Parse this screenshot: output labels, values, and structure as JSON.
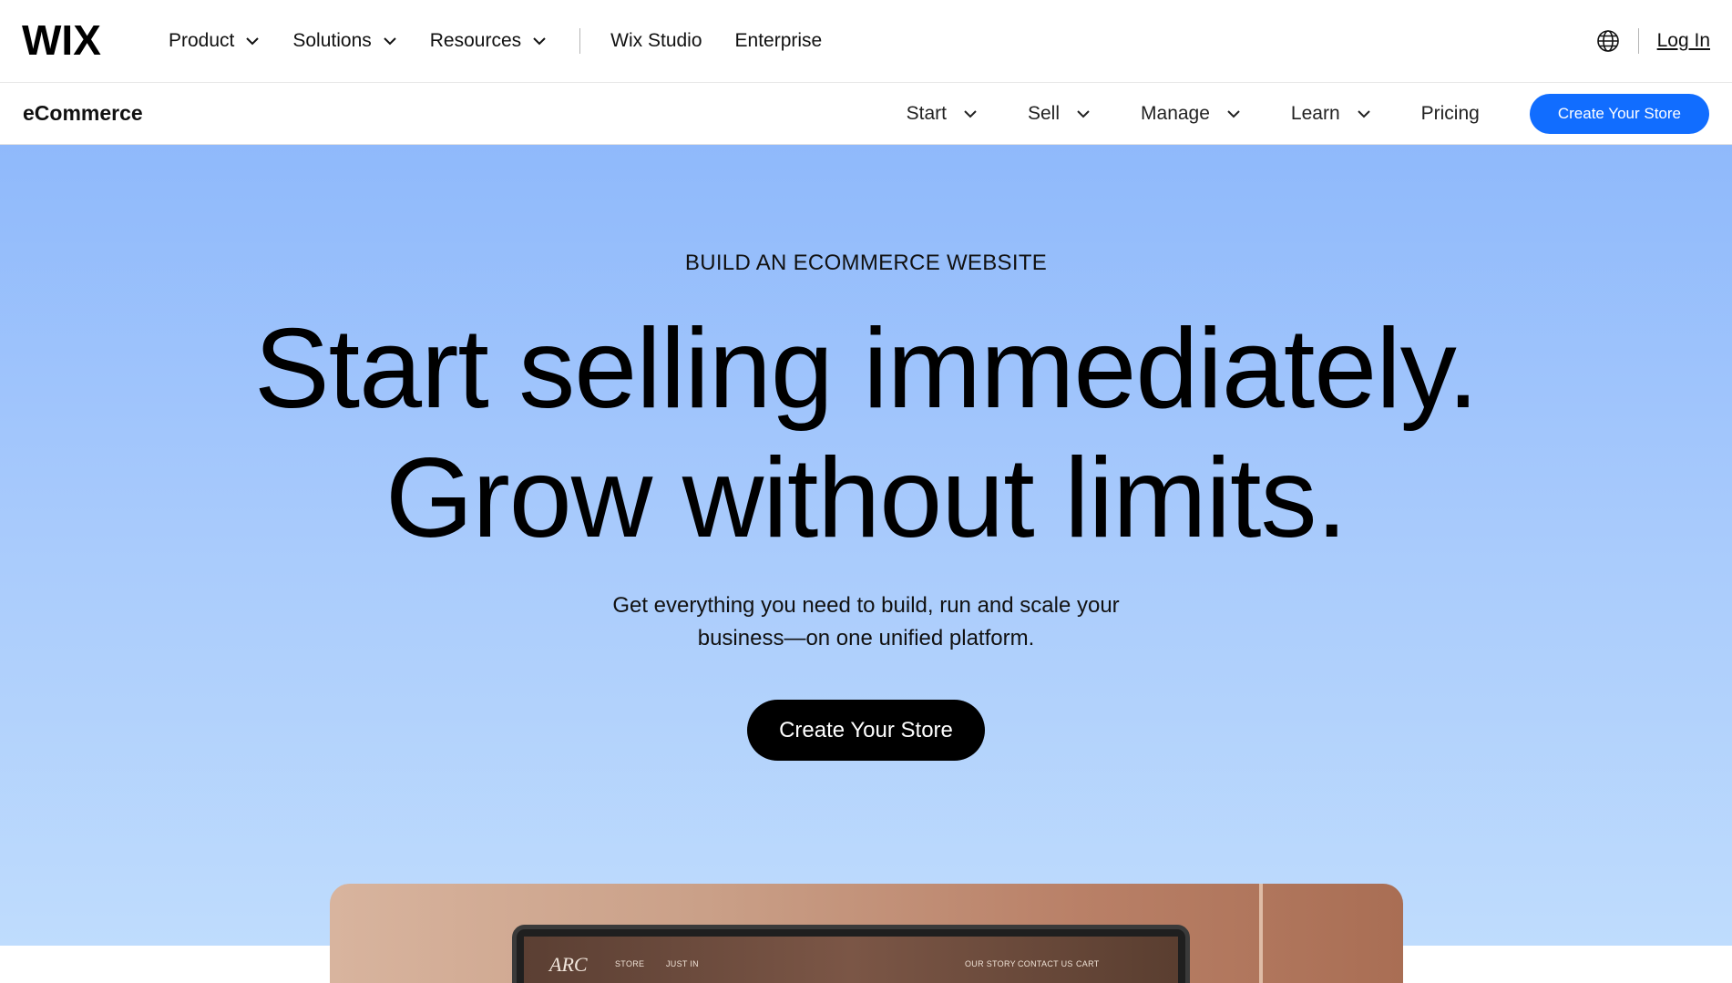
{
  "topbar": {
    "logo_text": "WIX",
    "nav": [
      {
        "label": "Product",
        "has_dropdown": true
      },
      {
        "label": "Solutions",
        "has_dropdown": true
      },
      {
        "label": "Resources",
        "has_dropdown": true
      },
      {
        "label": "Wix Studio",
        "has_dropdown": false
      },
      {
        "label": "Enterprise",
        "has_dropdown": false
      }
    ],
    "language_icon": "globe-icon",
    "login_label": "Log In"
  },
  "subbar": {
    "brand": "eCommerce",
    "nav": [
      {
        "label": "Start",
        "has_dropdown": true
      },
      {
        "label": "Sell",
        "has_dropdown": true
      },
      {
        "label": "Manage",
        "has_dropdown": true
      },
      {
        "label": "Learn",
        "has_dropdown": true
      },
      {
        "label": "Pricing",
        "has_dropdown": false
      }
    ],
    "cta_label": "Create Your Store"
  },
  "hero": {
    "eyebrow": "BUILD AN ECOMMERCE WEBSITE",
    "headline_line1": "Start selling immediately.",
    "headline_line2": "Grow without limits.",
    "subtext_line1": "Get everything you need to build, run and scale your",
    "subtext_line2": "business—on one unified platform.",
    "cta_label": "Create Your Store"
  },
  "preview": {
    "site_logo": "ARC",
    "site_nav_left": [
      "STORE",
      "JUST IN"
    ],
    "site_nav_right": [
      "OUR STORY",
      "CONTACT US",
      "CART"
    ]
  },
  "colors": {
    "accent_blue": "#116dff",
    "hero_gradient_top": "#8fb9fb",
    "hero_gradient_bottom": "#bfdcfd",
    "cta_black": "#000000"
  }
}
